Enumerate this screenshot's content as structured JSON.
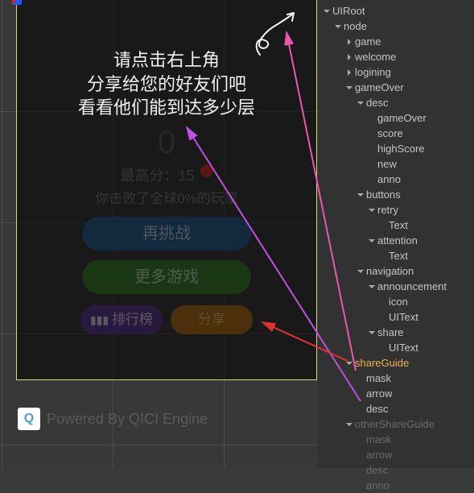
{
  "share_guide": {
    "line1": "请点击右上角",
    "line2": "分享给您的好友们吧",
    "line3": "看看他们能到达多少层"
  },
  "game_over": {
    "score": "0",
    "high_score_label": "最高分：",
    "high_score_value": "15",
    "beat_text": "你击败了全球0%的玩家",
    "retry_btn": "再挑战",
    "more_games_btn": "更多游戏",
    "leaderboard_btn": "排行榜",
    "share_btn": "分享"
  },
  "footer": {
    "powered": "Powered By QICI Engine",
    "logo_text": "QICI"
  },
  "hierarchy": [
    {
      "label": "UIRoot",
      "depth": 0,
      "expanded": true
    },
    {
      "label": "node",
      "depth": 1,
      "expanded": true
    },
    {
      "label": "game",
      "depth": 2,
      "collapsed": true
    },
    {
      "label": "welcome",
      "depth": 2,
      "collapsed": true
    },
    {
      "label": "logining",
      "depth": 2,
      "collapsed": true
    },
    {
      "label": "gameOver",
      "depth": 2,
      "expanded": true
    },
    {
      "label": "desc",
      "depth": 3,
      "expanded": true
    },
    {
      "label": "gameOver",
      "depth": 4
    },
    {
      "label": "score",
      "depth": 4
    },
    {
      "label": "highScore",
      "depth": 4
    },
    {
      "label": "new",
      "depth": 4
    },
    {
      "label": "anno",
      "depth": 4
    },
    {
      "label": "buttons",
      "depth": 3,
      "expanded": true
    },
    {
      "label": "retry",
      "depth": 4,
      "expanded": true
    },
    {
      "label": "Text",
      "depth": 5
    },
    {
      "label": "attention",
      "depth": 4,
      "expanded": true
    },
    {
      "label": "Text",
      "depth": 5
    },
    {
      "label": "navigation",
      "depth": 3,
      "expanded": true
    },
    {
      "label": "announcement",
      "depth": 4,
      "expanded": true
    },
    {
      "label": "icon",
      "depth": 5
    },
    {
      "label": "UIText",
      "depth": 5
    },
    {
      "label": "share",
      "depth": 4,
      "expanded": true
    },
    {
      "label": "UIText",
      "depth": 5
    },
    {
      "label": "shareGuide",
      "depth": 2,
      "expanded": true,
      "selected": true
    },
    {
      "label": "mask",
      "depth": 3
    },
    {
      "label": "arrow",
      "depth": 3
    },
    {
      "label": "desc",
      "depth": 3
    },
    {
      "label": "otherShareGuide",
      "depth": 2,
      "expanded": true,
      "dim": true
    },
    {
      "label": "mask",
      "depth": 3,
      "dim": true
    },
    {
      "label": "arrow",
      "depth": 3,
      "dim": true
    },
    {
      "label": "desc",
      "depth": 3,
      "dim": true
    },
    {
      "label": "anno",
      "depth": 3,
      "dim": true
    }
  ]
}
